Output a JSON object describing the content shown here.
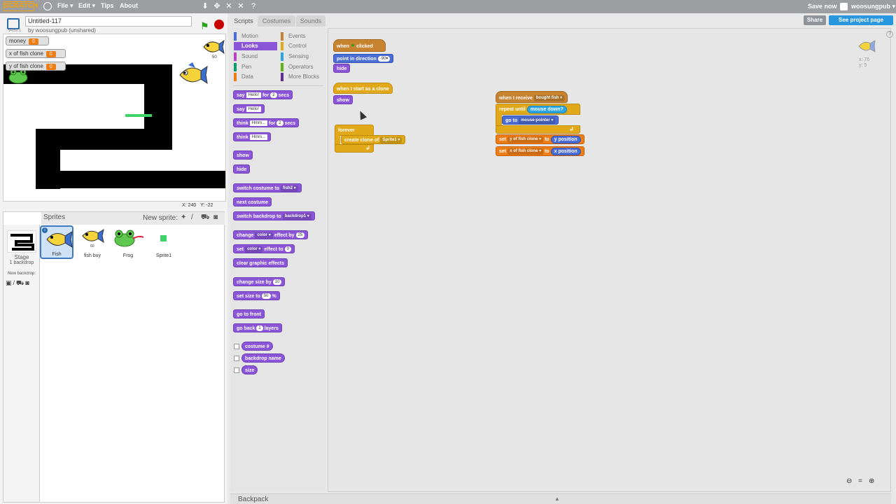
{
  "topbar": {
    "logo": "SCRATCH",
    "menus": [
      "File ▾",
      "Edit ▾",
      "Tips",
      "About"
    ],
    "save_now": "Save now",
    "username": "woosungpub ▾"
  },
  "project": {
    "title": "Untitled-117",
    "byline": "by woosungpub (unshared)",
    "version": "v459.1"
  },
  "stage": {
    "readouts": [
      {
        "label": "money",
        "value": "0"
      },
      {
        "label": "x of fish clone",
        "value": "0"
      },
      {
        "label": "y of fish clone",
        "value": "0"
      }
    ],
    "fish_value": "50",
    "mouse_x_label": "X: 240",
    "mouse_y_label": "Y: -22"
  },
  "sprites_pane": {
    "title": "Sprites",
    "new_sprite_label": "New sprite:",
    "stage_name": "Stage",
    "stage_backdrops": "1 backdrop",
    "new_backdrop_label": "New backdrop:",
    "sprites": [
      {
        "name": "Fish",
        "selected": true
      },
      {
        "name": "fish buy",
        "selected": false,
        "value": "60"
      },
      {
        "name": "Frog",
        "selected": false
      },
      {
        "name": "Sprite1",
        "selected": false
      }
    ]
  },
  "tabs": {
    "scripts": "Scripts",
    "costumes": "Costumes",
    "sounds": "Sounds"
  },
  "categories": [
    {
      "label": "Motion",
      "color": "#4a6cd4"
    },
    {
      "label": "Events",
      "color": "#c88330"
    },
    {
      "label": "Looks",
      "color": "#8a55d7",
      "active": true
    },
    {
      "label": "Control",
      "color": "#e1a91a"
    },
    {
      "label": "Sound",
      "color": "#bb42c3"
    },
    {
      "label": "Sensing",
      "color": "#2ca5e2"
    },
    {
      "label": "Pen",
      "color": "#0e9a6c"
    },
    {
      "label": "Operators",
      "color": "#5cb712"
    },
    {
      "label": "Data",
      "color": "#ee7d16"
    },
    {
      "label": "More Blocks",
      "color": "#632d99"
    }
  ],
  "palette": {
    "say_for_a": "say",
    "say_for_input": "Hello!",
    "say_for_b": "for",
    "say_for_secs": "2",
    "say_for_c": "secs",
    "say": "say",
    "say_input": "Hello!",
    "think_for_a": "think",
    "think_for_input": "Hmm...",
    "think_for_b": "for",
    "think_for_secs": "2",
    "think_for_c": "secs",
    "think": "think",
    "think_input": "Hmm...",
    "show": "show",
    "hide": "hide",
    "switch_costume": "switch costume to",
    "switch_costume_val": "fish2 ▾",
    "next_costume": "next costume",
    "switch_backdrop": "switch backdrop to",
    "switch_backdrop_val": "backdrop1 ▾",
    "change_effect_a": "change",
    "change_effect_dd": "color ▾",
    "change_effect_b": "effect by",
    "change_effect_val": "25",
    "set_effect_a": "set",
    "set_effect_dd": "color ▾",
    "set_effect_b": "effect to",
    "set_effect_val": "0",
    "clear_effects": "clear graphic effects",
    "change_size_a": "change size by",
    "change_size_val": "10",
    "set_size_a": "set size to",
    "set_size_val": "50",
    "set_size_b": "%",
    "go_front": "go to front",
    "go_back_a": "go back",
    "go_back_val": "1",
    "go_back_b": "layers",
    "costume_num": "costume #",
    "backdrop_name": "backdrop name",
    "size": "size"
  },
  "scripts": {
    "when_flag_a": "when",
    "when_flag_b": "clicked",
    "point_dir": "point in direction",
    "point_dir_val": "-90▾",
    "hide": "hide",
    "when_clone": "when I start as a clone",
    "show": "show",
    "forever": "forever",
    "create_clone": "create clone of",
    "create_clone_val": "Sprite1 ▾",
    "when_receive": "when I receive",
    "when_receive_val": "bought fish ▾",
    "repeat_until": "repeat until",
    "repeat_until_cond": "mouse down?",
    "go_to": "go to",
    "go_to_val": "mouse-pointer ▾",
    "set_y_a": "set",
    "set_y_var": "y of fish clone ▾",
    "set_y_b": "to",
    "set_y_val": "y position",
    "set_x_a": "set",
    "set_x_var": "x of fish clone ▾",
    "set_x_b": "to",
    "set_x_val": "x position",
    "sprite_x": "x: 76",
    "sprite_y": "y: 5"
  },
  "buttons": {
    "share": "Share",
    "see_project": "See project page",
    "help": "?"
  },
  "backpack": {
    "label": "Backpack"
  }
}
